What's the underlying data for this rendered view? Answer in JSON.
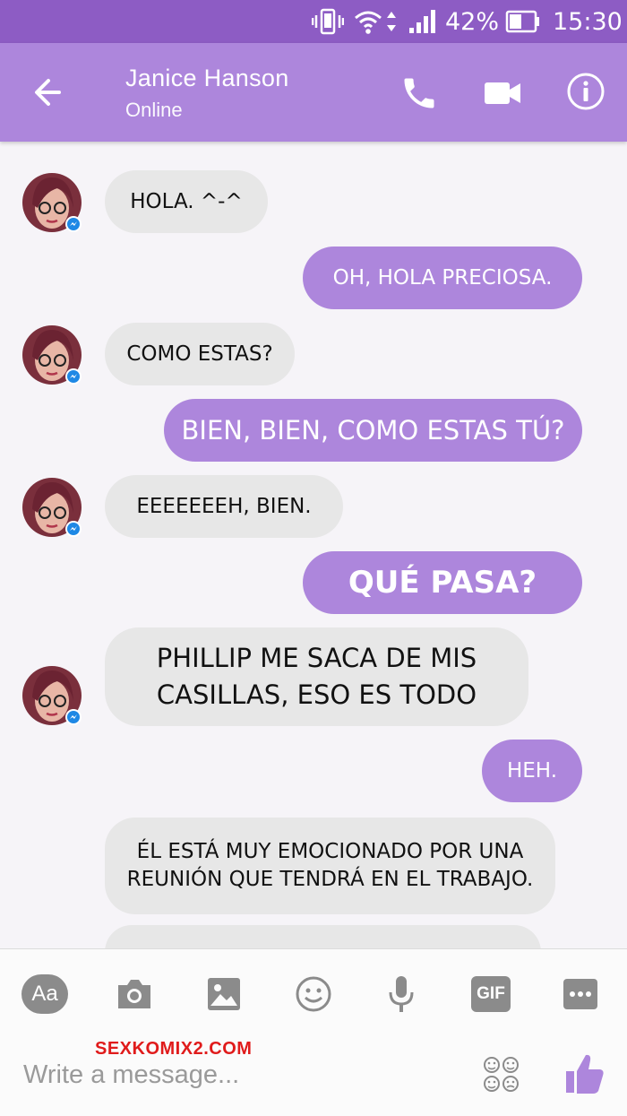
{
  "status_bar": {
    "battery": "42%",
    "time": "15:30"
  },
  "header": {
    "contact_name": "Janice Hanson",
    "contact_status": "Online"
  },
  "messages": [
    {
      "from": "contact",
      "text": "HOLA. ^-^"
    },
    {
      "from": "me",
      "text": "OH, HOLA PRECIOSA."
    },
    {
      "from": "contact",
      "text": "COMO ESTAS?"
    },
    {
      "from": "me",
      "text": "BIEN, BIEN, COMO ESTAS TÚ?"
    },
    {
      "from": "contact",
      "text": "EEEEEEEH, BIEN."
    },
    {
      "from": "me",
      "text": "QUÉ PASA?"
    },
    {
      "from": "contact",
      "text": "PHILLIP ME SACA DE MIS CASILLAS, ESO ES TODO"
    },
    {
      "from": "me",
      "text": "HEH."
    },
    {
      "from": "contact",
      "text": "ÉL ESTÁ MUY EMOCIONADO POR UNA REUNIÓN QUE TENDRÁ EN EL TRABAJO."
    }
  ],
  "composer": {
    "tools": [
      "text-format-icon",
      "camera-icon",
      "image-icon",
      "emoji-icon",
      "microphone-icon",
      "gif-icon",
      "more-icon"
    ],
    "aa_label": "Aa",
    "gif_label": "GIF",
    "placeholder": "Write a message...",
    "watermark": "SEXKOMIX2.COM"
  },
  "colors": {
    "status_bar": "#8d5cc4",
    "header": "#ad86dc",
    "outgoing_bubble": "#ad86dc",
    "incoming_bubble": "#e7e7e7",
    "messenger_badge": "#1e88e5"
  }
}
